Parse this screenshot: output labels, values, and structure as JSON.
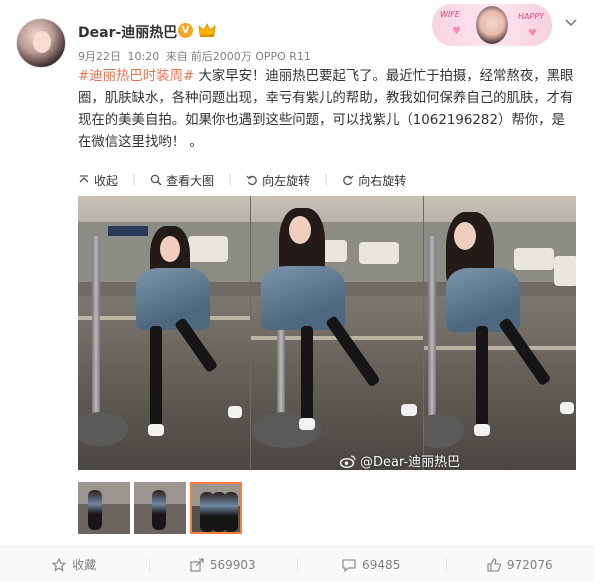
{
  "user": {
    "name": "Dear-迪丽热巴",
    "verified_mark": "V"
  },
  "banner": {
    "tag_left": "WIFE",
    "tag_right": "HAPPY"
  },
  "meta": {
    "date": "9月22日",
    "time": "10:20",
    "source_prefix": "来自",
    "source": "前后2000万 OPPO R11"
  },
  "post": {
    "hashtag": "#迪丽热巴时装周#",
    "text": " 大家早安！迪丽热巴要起飞了。最近忙于拍摄，经常熬夜，黑眼圈，肌肤缺水，各种问题出现，幸亏有紫儿的帮助，教我如何保养自己的肌肤，才有现在的美美自拍。如果你也遇到这些问题，可以找紫儿（1062196282）帮你，是在微信这里找哟！ 。"
  },
  "actions": [
    {
      "label": "收起",
      "icon": "collapse-icon"
    },
    {
      "label": "查看大图",
      "icon": "zoom-icon"
    },
    {
      "label": "向左旋转",
      "icon": "rotate-left-icon"
    },
    {
      "label": "向右旋转",
      "icon": "rotate-right-icon"
    }
  ],
  "photo": {
    "watermark": "@Dear-迪丽热巴"
  },
  "footer": {
    "favorite": {
      "label": "收藏",
      "icon": "star-icon"
    },
    "share": {
      "label": "569903",
      "icon": "share-icon"
    },
    "comment": {
      "label": "69485",
      "icon": "comment-icon"
    },
    "like": {
      "label": "972076",
      "icon": "thumbs-up-icon"
    }
  },
  "colors": {
    "hashtag": "#eb7350",
    "verified": "#f5a623",
    "thumb_selected": "#fa7d3c"
  }
}
